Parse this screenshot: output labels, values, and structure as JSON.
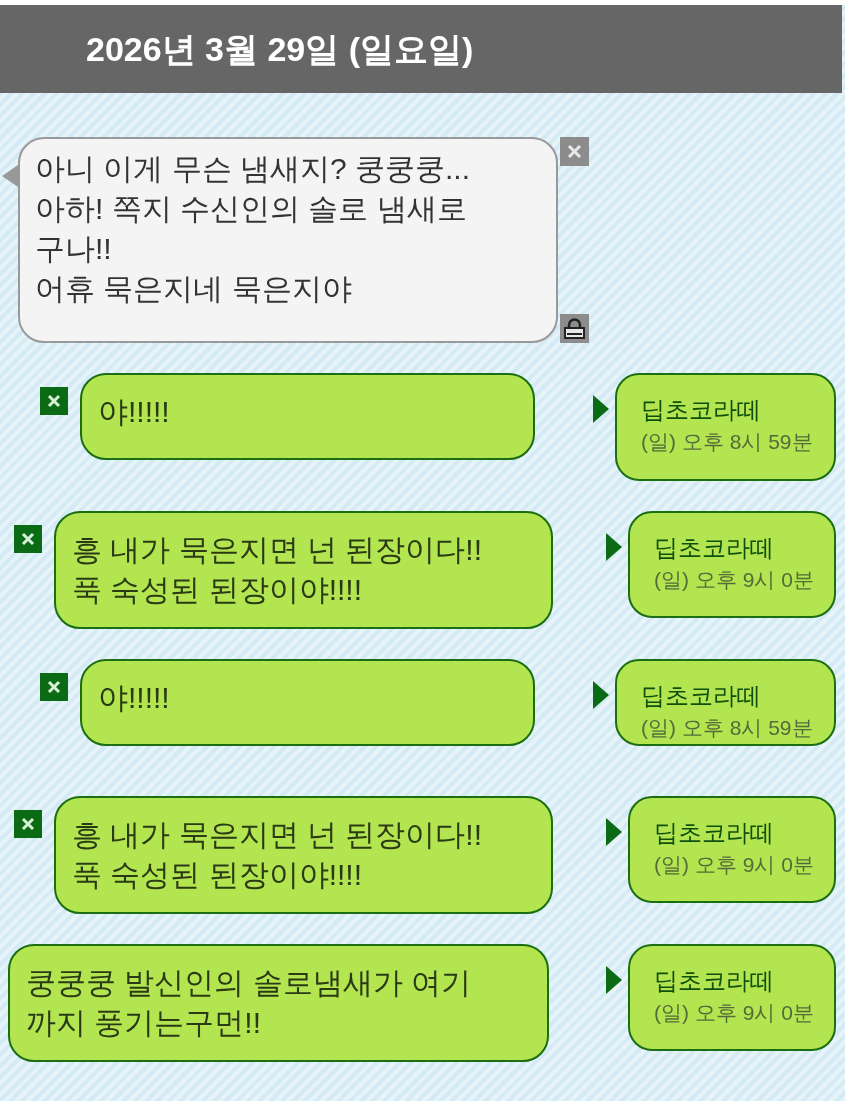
{
  "header": {
    "date": "2026년 3월 29일 (일요일)"
  },
  "messages": [
    {
      "kind": "received",
      "lines": [
        "아니 이게 무슨 냄새지? 쿵쿵쿵...",
        "아하! 쪽지 수신인의 솔로 냄새로",
        "구나!!",
        "어휴 묵은지네 묵은지야"
      ]
    },
    {
      "kind": "sent",
      "lines": [
        "야!!!!!"
      ],
      "sender": "딥초코라떼",
      "time": "(일) 오후 8시 59분"
    },
    {
      "kind": "sent",
      "lines": [
        "흥 내가 묵은지면 넌 된장이다!!",
        "푹 숙성된 된장이야!!!!"
      ],
      "sender": "딥초코라떼",
      "time": "(일) 오후 9시 0분"
    },
    {
      "kind": "sent",
      "lines": [
        "야!!!!!"
      ],
      "sender": "딥초코라떼",
      "time": "(일) 오후 8시 59분"
    },
    {
      "kind": "sent",
      "lines": [
        "흥 내가 묵은지면 넌 된장이다!!",
        "푹 숙성된 된장이야!!!!"
      ],
      "sender": "딥초코라떼",
      "time": "(일) 오후 9시 0분"
    },
    {
      "kind": "sent",
      "lines": [
        "쿵쿵쿵 발신인의 솔로냄새가 여기",
        "까지 풍기는구먼!!"
      ],
      "sender": "딥초코라떼",
      "time": "(일) 오후 9시 0분"
    }
  ]
}
